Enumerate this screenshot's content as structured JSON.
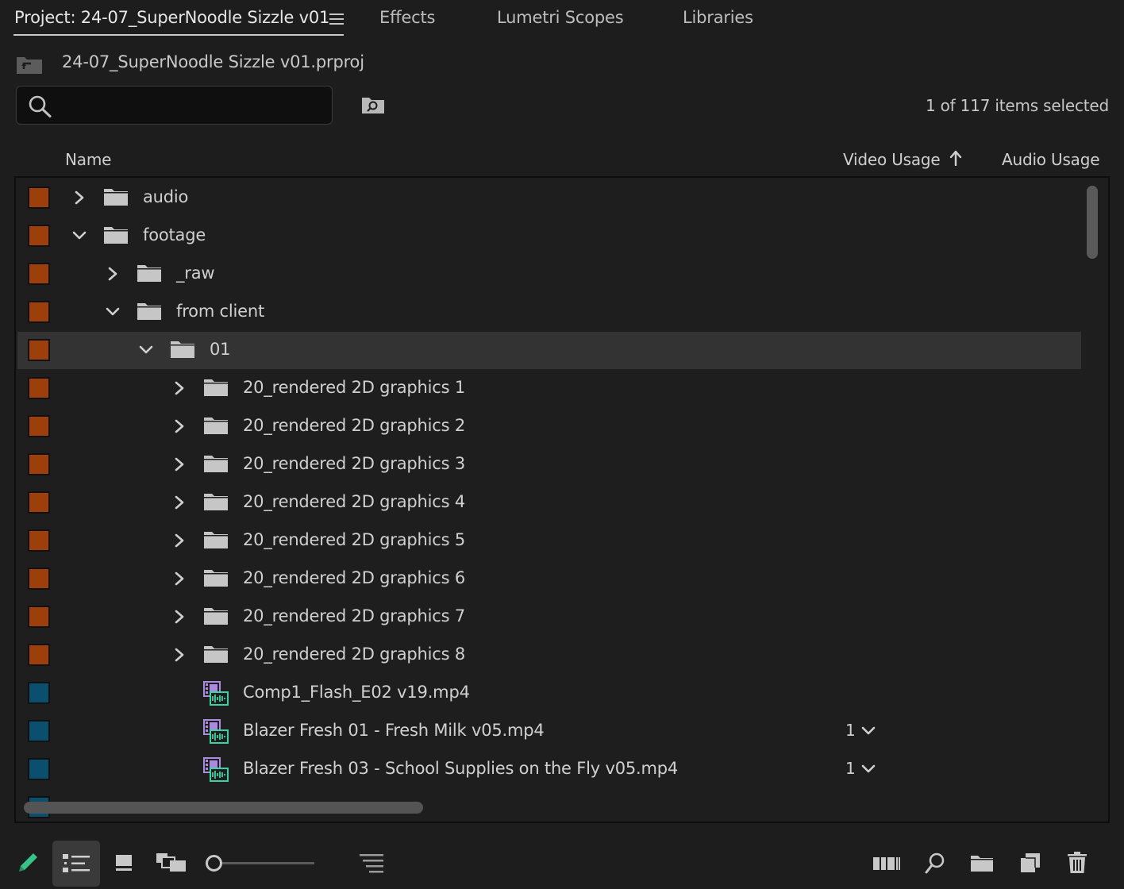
{
  "tabs": [
    {
      "label": "Project: 24-07_SuperNoodle Sizzle v01",
      "active": true
    },
    {
      "label": "Effects",
      "active": false
    },
    {
      "label": "Lumetri Scopes",
      "active": false
    },
    {
      "label": "Libraries",
      "active": false
    }
  ],
  "project": {
    "file_name": "24-07_SuperNoodle Sizzle v01.prproj"
  },
  "search": {
    "value": "",
    "placeholder": ""
  },
  "status": {
    "selection_text": "1 of 117 items selected"
  },
  "columns": {
    "name": "Name",
    "video_usage": "Video Usage",
    "audio_usage": "Audio Usage",
    "sort": "video_usage ascending"
  },
  "colors": {
    "folder_label": "#9c3f0a",
    "clip_label": "#0a4f6e",
    "selected_row": "#333333",
    "background": "#1d1d1d"
  },
  "rows": [
    {
      "name": "audio",
      "type": "folder",
      "depth": 0,
      "expanded": false,
      "label_color": "#9c3f0a",
      "video_usage": "",
      "selected": false
    },
    {
      "name": "footage",
      "type": "folder",
      "depth": 0,
      "expanded": true,
      "label_color": "#9c3f0a",
      "video_usage": "",
      "selected": false
    },
    {
      "name": "_raw",
      "type": "folder",
      "depth": 1,
      "expanded": false,
      "label_color": "#9c3f0a",
      "video_usage": "",
      "selected": false
    },
    {
      "name": "from client",
      "type": "folder",
      "depth": 1,
      "expanded": true,
      "label_color": "#9c3f0a",
      "video_usage": "",
      "selected": false
    },
    {
      "name": "01",
      "type": "folder",
      "depth": 2,
      "expanded": true,
      "label_color": "#9c3f0a",
      "video_usage": "",
      "selected": true
    },
    {
      "name": "20_rendered 2D graphics 1",
      "type": "folder",
      "depth": 3,
      "expanded": false,
      "label_color": "#9c3f0a",
      "video_usage": "",
      "selected": false
    },
    {
      "name": "20_rendered 2D graphics 2",
      "type": "folder",
      "depth": 3,
      "expanded": false,
      "label_color": "#9c3f0a",
      "video_usage": "",
      "selected": false
    },
    {
      "name": "20_rendered 2D graphics 3",
      "type": "folder",
      "depth": 3,
      "expanded": false,
      "label_color": "#9c3f0a",
      "video_usage": "",
      "selected": false
    },
    {
      "name": "20_rendered 2D graphics 4",
      "type": "folder",
      "depth": 3,
      "expanded": false,
      "label_color": "#9c3f0a",
      "video_usage": "",
      "selected": false
    },
    {
      "name": "20_rendered 2D graphics 5",
      "type": "folder",
      "depth": 3,
      "expanded": false,
      "label_color": "#9c3f0a",
      "video_usage": "",
      "selected": false
    },
    {
      "name": "20_rendered 2D graphics 6",
      "type": "folder",
      "depth": 3,
      "expanded": false,
      "label_color": "#9c3f0a",
      "video_usage": "",
      "selected": false
    },
    {
      "name": "20_rendered 2D graphics 7",
      "type": "folder",
      "depth": 3,
      "expanded": false,
      "label_color": "#9c3f0a",
      "video_usage": "",
      "selected": false
    },
    {
      "name": "20_rendered 2D graphics 8",
      "type": "folder",
      "depth": 3,
      "expanded": false,
      "label_color": "#9c3f0a",
      "video_usage": "",
      "selected": false
    },
    {
      "name": "Comp1_Flash_E02 v19.mp4",
      "type": "clip",
      "depth": 3,
      "expanded": false,
      "label_color": "#0a4f6e",
      "video_usage": "",
      "selected": false
    },
    {
      "name": "Blazer Fresh 01 - Fresh Milk v05.mp4",
      "type": "clip",
      "depth": 3,
      "expanded": false,
      "label_color": "#0a4f6e",
      "video_usage": "1",
      "selected": false
    },
    {
      "name": "Blazer Fresh 03 - School Supplies on the Fly v05.mp4",
      "type": "clip",
      "depth": 3,
      "expanded": false,
      "label_color": "#0a4f6e",
      "video_usage": "1",
      "selected": false
    }
  ],
  "toolbar": {
    "icons": [
      "pencil-icon",
      "list-view-icon",
      "icon-view-icon",
      "freeform-view-icon",
      "zoom-slider",
      "sort-icon",
      "automate-to-sequence-icon",
      "find-icon",
      "new-bin-icon",
      "new-item-icon",
      "trash-icon"
    ],
    "active_view": "list",
    "zoom_level": 0.0
  }
}
